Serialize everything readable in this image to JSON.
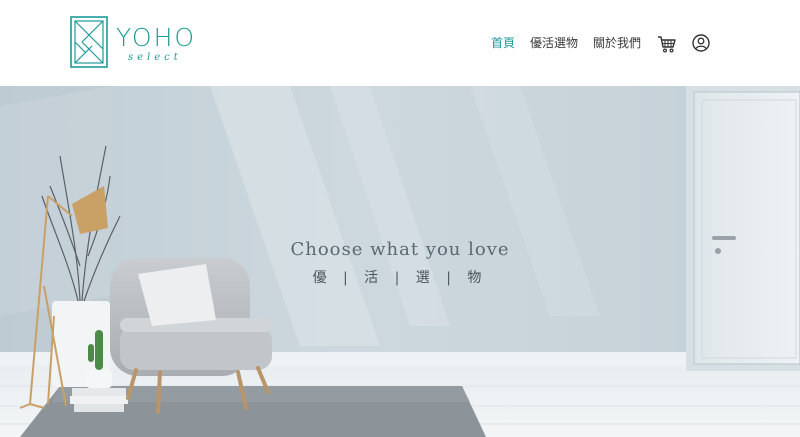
{
  "brand": {
    "name": "YOHO",
    "script": "select",
    "color": "#1e9a98"
  },
  "nav": {
    "items": [
      {
        "label": "首頁",
        "active": true
      },
      {
        "label": "優活選物",
        "active": false
      },
      {
        "label": "關於我們",
        "active": false
      }
    ],
    "icons": [
      "cart-icon",
      "user-icon"
    ]
  },
  "hero": {
    "tagline": "Choose what you love",
    "subtitle": "優 | 活 | 選 | 物"
  }
}
